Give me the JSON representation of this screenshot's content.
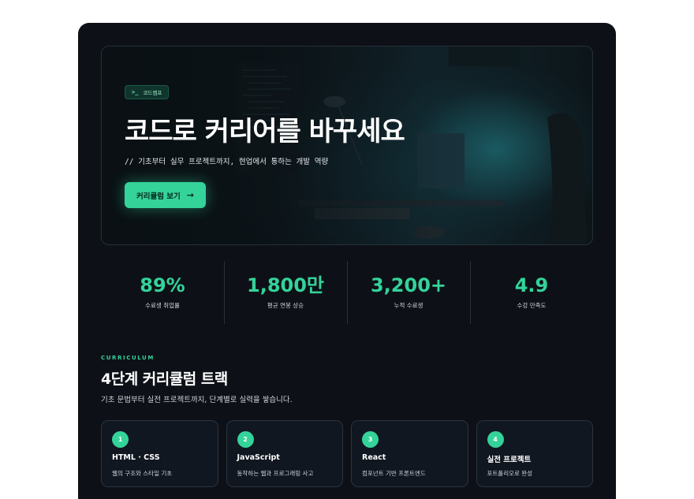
{
  "hero": {
    "badge_icon": ">_",
    "badge_label": "코드캠프",
    "title": "코드로 커리어를 바꾸세요",
    "subtitle": "// 기초부터 실무 프로젝트까지, 현업에서 통하는 개발 역량",
    "cta_label": "커리큘럼 보기",
    "cta_icon": "→",
    "accent_color": "#34d399"
  },
  "stats": [
    {
      "value": "89%",
      "label": "수료생 취업률"
    },
    {
      "value": "1,800만",
      "label": "평균 연봉 상승"
    },
    {
      "value": "3,200+",
      "label": "누적 수료생"
    },
    {
      "value": "4.9",
      "label": "수강 만족도"
    }
  ],
  "curriculum": {
    "eyebrow": "CURRICULUM",
    "title": "4단계 커리큘럼 트랙",
    "description": "기초 문법부터 실전 프로젝트까지, 단계별로 실력을 쌓습니다.",
    "cards": [
      {
        "step": "1",
        "title": "HTML · CSS",
        "desc": "웹의 구조와 스타일 기초"
      },
      {
        "step": "2",
        "title": "JavaScript",
        "desc": "동작하는 웹과 프로그래밍 사고"
      },
      {
        "step": "3",
        "title": "React",
        "desc": "컴포넌트 기반 프론트엔드"
      },
      {
        "step": "4",
        "title": "실전 프로젝트",
        "desc": "포트폴리오로 완성"
      }
    ]
  }
}
